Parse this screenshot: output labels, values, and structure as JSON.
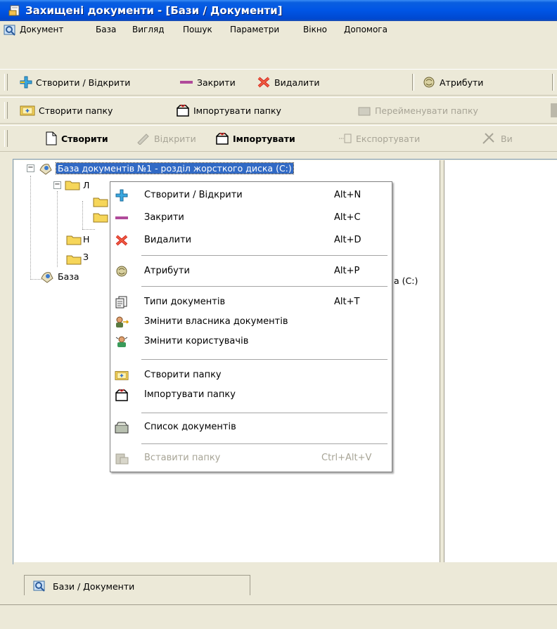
{
  "window": {
    "title": "Захищені документи - [Бази / Документи]"
  },
  "menu": [
    "Документ",
    "База",
    "Вигляд",
    "Пошук",
    "Параметри",
    "Вікно",
    "Допомога"
  ],
  "toolbar1": {
    "create_open": "Створити / Відкрити",
    "close": "Закрити",
    "delete": "Видалити",
    "attributes": "Атрибути"
  },
  "toolbar2": {
    "create_folder": "Створити папку",
    "import_folder": "Імпортувати папку",
    "rename_folder": "Перейменувати папку"
  },
  "toolbar3": {
    "create": "Створити",
    "open": "Відкрити",
    "import": "Імпортувати",
    "export": "Експортувати",
    "partial": "Ви"
  },
  "tree": {
    "root_selected": "База документів №1 - розділ жорсткого диска (C:)",
    "child1_partial": "Л",
    "child3_partial": "Н",
    "child4_partial": "З",
    "root2_partial_left": "База",
    "root2_partial_right": "а (C:)"
  },
  "context_menu": {
    "items": [
      {
        "label": "Створити / Відкрити",
        "shortcut": "Alt+N",
        "icon": "plus-icon"
      },
      {
        "label": "Закрити",
        "shortcut": "Alt+C",
        "icon": "minus-icon"
      },
      {
        "label": "Видалити",
        "shortcut": "Alt+D",
        "icon": "delete-icon"
      },
      {
        "label": "Атрибути",
        "shortcut": "Alt+P",
        "icon": "attributes-icon"
      },
      {
        "label": "Типи документів",
        "shortcut": "Alt+T",
        "icon": "doc-types-icon"
      },
      {
        "label": "Змінити власника документів",
        "shortcut": "",
        "icon": "owner-icon"
      },
      {
        "label": "Змінити користувачів",
        "shortcut": "",
        "icon": "users-icon"
      },
      {
        "label": "Створити папку",
        "shortcut": "",
        "icon": "new-folder-icon"
      },
      {
        "label": "Імпортувати папку",
        "shortcut": "",
        "icon": "import-folder-icon"
      },
      {
        "label": "Список документів",
        "shortcut": "",
        "icon": "doc-list-icon"
      },
      {
        "label": "Вставити папку",
        "shortcut": "Ctrl+Alt+V",
        "icon": "paste-folder-icon"
      }
    ]
  },
  "bottom_tab": {
    "label": "Бази / Документи"
  },
  "colors": {
    "title_bar": "#0055e5",
    "selection": "#316ac5",
    "chrome": "#ECE9D8"
  }
}
